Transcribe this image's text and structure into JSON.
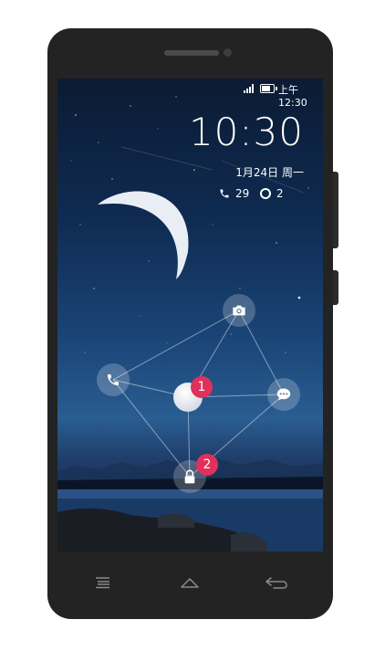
{
  "status_bar": {
    "time": "上午12:30"
  },
  "lockscreen": {
    "clock": "10:30",
    "date": "1月24日  周一",
    "missed_calls": "29",
    "unread_messages": "2"
  },
  "unlock_pattern": {
    "badge_1": "1",
    "badge_2": "2"
  },
  "icons": {
    "camera": "camera-icon",
    "phone": "phone-icon",
    "message": "message-icon",
    "lock": "lock-icon",
    "menu": "menu-icon",
    "home": "home-icon",
    "back": "back-icon"
  },
  "colors": {
    "badge": "#e0315a",
    "phone_body": "#232323"
  }
}
